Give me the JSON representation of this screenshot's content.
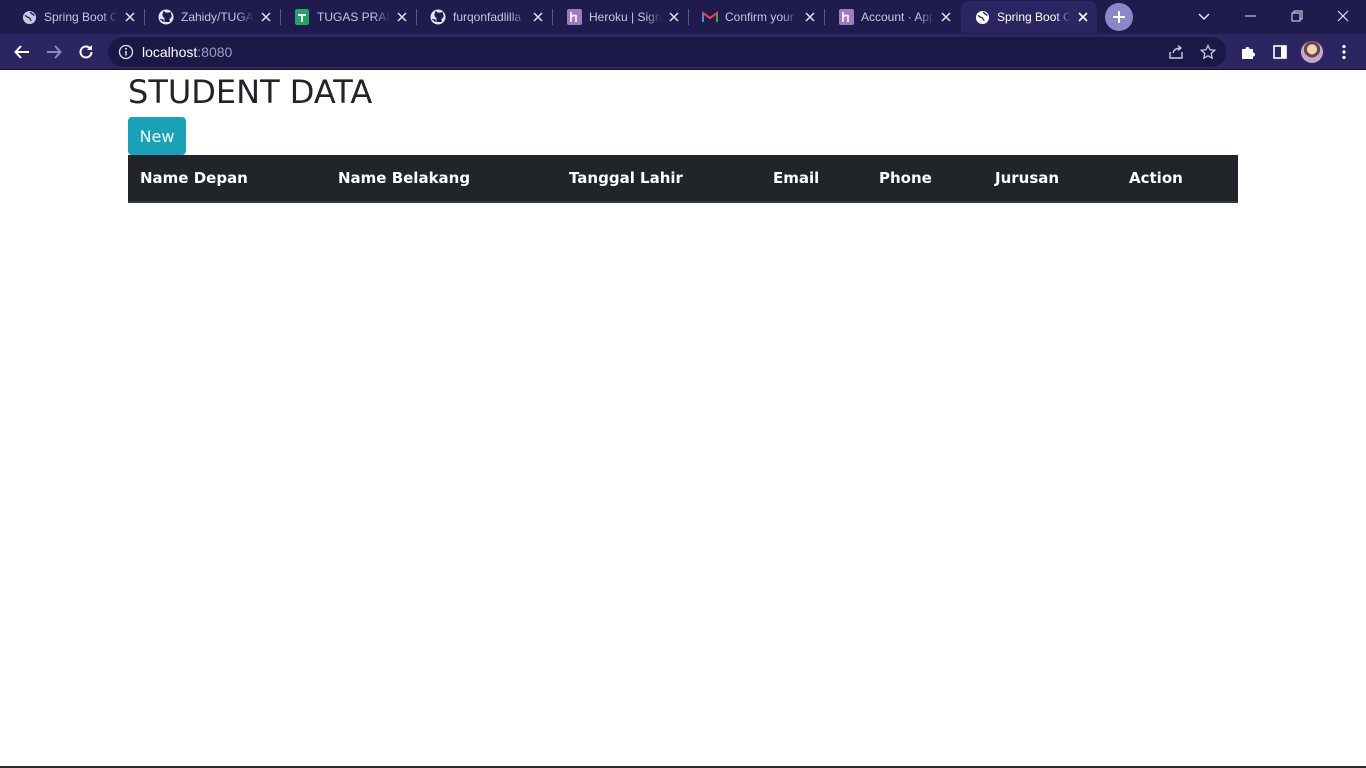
{
  "browser": {
    "tabs": [
      {
        "title": "Spring Boot C",
        "icon": "globe-icon",
        "active": false
      },
      {
        "title": "Zahidy/TUGA",
        "icon": "github-icon",
        "active": false
      },
      {
        "title": "TUGAS PRAK",
        "icon": "sheets-icon",
        "active": false
      },
      {
        "title": "furqonfadlilla",
        "icon": "github-icon",
        "active": false
      },
      {
        "title": "Heroku | Sign",
        "icon": "heroku-icon",
        "active": false
      },
      {
        "title": "Confirm your",
        "icon": "gmail-icon",
        "active": false
      },
      {
        "title": "Account · App",
        "icon": "heroku-icon",
        "active": false
      },
      {
        "title": "Spring Boot C",
        "icon": "globe-icon",
        "active": true
      }
    ],
    "address": {
      "host": "localhost",
      "port": ":8080"
    },
    "colors": {
      "tabstrip": "#1f1b4d",
      "toolbar": "#2b2662",
      "omnibox": "#1b1747"
    }
  },
  "page": {
    "title": "STUDENT DATA",
    "new_button": "New",
    "table": {
      "columns": [
        "Name Depan",
        "Name Belakang",
        "Tanggal Lahir",
        "Email",
        "Phone",
        "Jurusan",
        "Action"
      ],
      "rows": []
    },
    "colors": {
      "button": "#17a2b8",
      "table_header": "#212529",
      "text": "#212529"
    }
  }
}
